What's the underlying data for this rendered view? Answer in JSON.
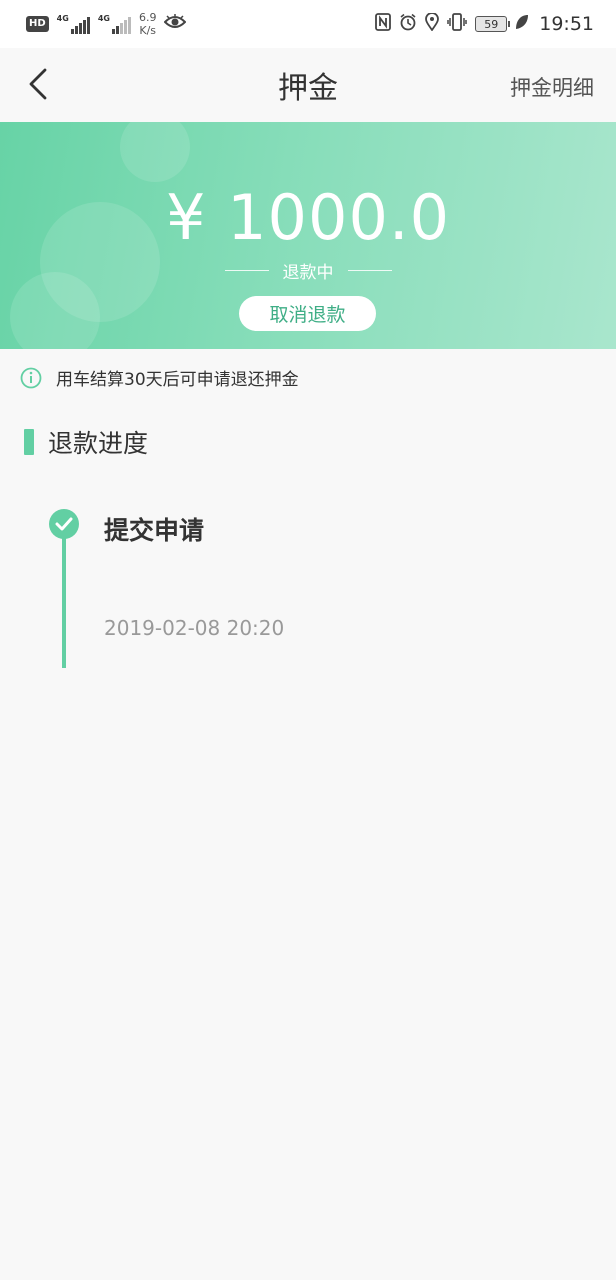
{
  "status_bar": {
    "hd": "HD",
    "net1": "4G",
    "net2": "4G",
    "speed_value": "6.9",
    "speed_unit": "K/s",
    "battery": "59",
    "time": "19:51"
  },
  "nav": {
    "title": "押金",
    "right_link": "押金明细"
  },
  "deposit": {
    "amount": "¥ 1000.0",
    "status": "退款中",
    "cancel_label": "取消退款"
  },
  "tip": "用车结算30天后可申请退还押金",
  "progress": {
    "title": "退款进度",
    "steps": [
      {
        "title": "提交申请",
        "time": "2019-02-08 20:20"
      }
    ]
  },
  "colors": {
    "accent": "#62cfa3",
    "accent_text": "#3fae86"
  }
}
